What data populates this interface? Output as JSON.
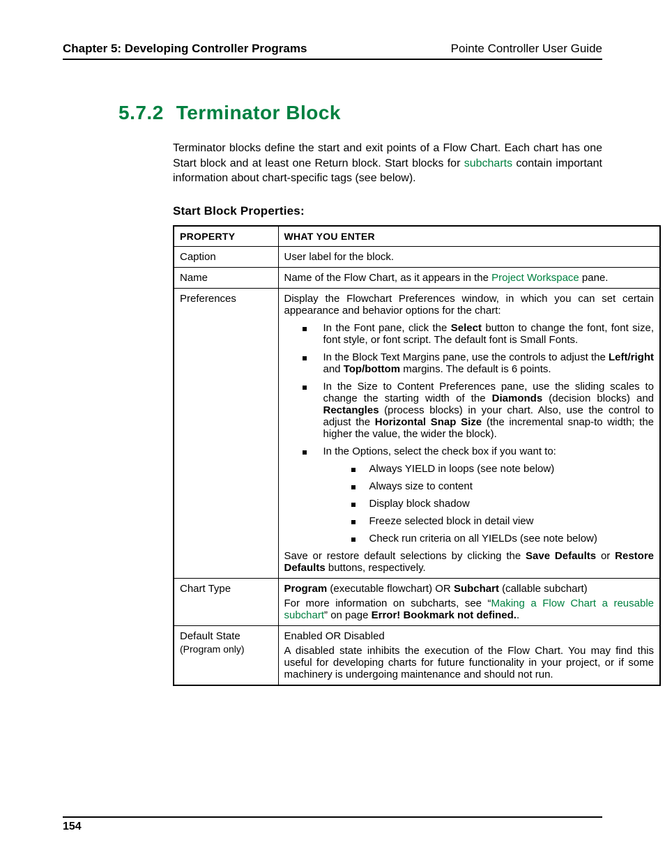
{
  "header": {
    "left": "Chapter 5: Developing Controller Programs",
    "right": "Pointe Controller User Guide"
  },
  "section": {
    "number": "5.7.2",
    "title": "Terminator Block"
  },
  "intro": {
    "pre": "Terminator blocks define the start and exit points of a Flow Chart. Each chart has one Start block and at least one Return block. Start blocks for ",
    "link": "subcharts",
    "post": " contain important information about chart-specific tags (see below)."
  },
  "subheading": "Start Block Properties:",
  "table": {
    "head": {
      "c1": "PROPERTY",
      "c2": "WHAT YOU ENTER"
    },
    "caption_row": {
      "prop": "Caption",
      "val": "User label for the block."
    },
    "name_row": {
      "prop": "Name",
      "pre": "Name of the Flow Chart, as it appears in the ",
      "link": "Project Workspace",
      "post": " pane."
    },
    "prefs_row": {
      "prop": "Preferences",
      "intro": "Display the Flowchart Preferences window, in which you can set certain appearance and behavior options for the chart:",
      "b1_pre": "In the Font pane, click the ",
      "b1_bold1": "Select",
      "b1_post": " button to change the font, font size, font style, or font script. The default font is Small Fonts.",
      "b2_pre": "In the Block Text Margins pane, use the controls to adjust the ",
      "b2_bold1": "Left/right",
      "b2_mid": " and ",
      "b2_bold2": "Top/bottom",
      "b2_post": " margins. The default is 6 points.",
      "b3_pre": "In the Size to Content Preferences pane, use the sliding scales to change the starting width of the ",
      "b3_bold1": "Diamonds",
      "b3_mid1": " (decision blocks) and ",
      "b3_bold2": "Rectangles",
      "b3_mid2": " (process blocks) in your chart. Also, use the control to adjust the ",
      "b3_bold3": "Horizontal Snap Size",
      "b3_post": " (the incremental snap-to width; the higher the value, the wider the block).",
      "b4": "In the Options, select the check box if you want to:",
      "opts": {
        "o1": "Always YIELD in loops (see note below)",
        "o2": "Always size to content",
        "o3": "Display block shadow",
        "o4": "Freeze selected block in detail view",
        "o5": "Check run criteria on all YIELDs (see note below)"
      },
      "footer_pre": "Save or restore default selections by clicking the ",
      "footer_bold1": "Save Defaults",
      "footer_mid": " or ",
      "footer_bold2": "Restore Defaults",
      "footer_post": " buttons, respectively."
    },
    "chart_type_row": {
      "prop": "Chart Type",
      "l1_bold1": "Program",
      "l1_mid": " (executable flowchart) OR ",
      "l1_bold2": "Subchart",
      "l1_post": " (callable subchart)",
      "l2_pre": "For more information on subcharts, see “",
      "l2_link": "Making a Flow Chart a reusable subchart",
      "l2_mid": "” on page ",
      "l2_bold": "Error! Bookmark not defined.",
      "l2_post": "."
    },
    "default_state_row": {
      "prop_l1": "Default State",
      "prop_l2": "(Program only)",
      "val_l1": "Enabled OR Disabled",
      "val_l2": "A disabled state inhibits the execution of the Flow Chart. You may find this useful for developing charts for future functionality in your project, or if some machinery is undergoing maintenance and should not run."
    }
  },
  "page_number": "154"
}
